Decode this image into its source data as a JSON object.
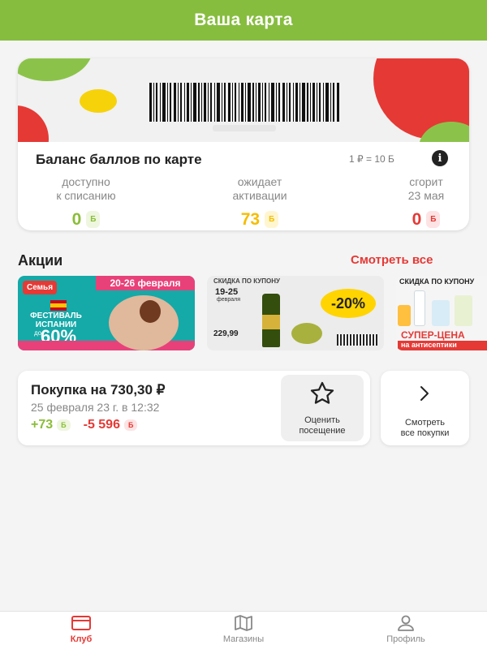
{
  "header": {
    "title": "Ваша карта"
  },
  "card": {
    "balance_title": "Баланс баллов по карте",
    "rate": "1 ₽ = 10 Б",
    "stats": [
      {
        "label_line1": "доступно",
        "label_line2": "к списанию",
        "value": "0",
        "unit": "Б",
        "color": "#8bbd39"
      },
      {
        "label_line1": "ожидает",
        "label_line2": "активации",
        "value": "73",
        "unit": "Б",
        "color": "#f5bd02"
      },
      {
        "label_line1": "сгорит",
        "label_line2": "23 мая",
        "value": "0",
        "unit": "Б",
        "color": "#e53935"
      }
    ]
  },
  "promos": {
    "title": "Акции",
    "see_all": "Смотреть все",
    "banners": [
      {
        "logo": "Семья",
        "date": "20-26 февраля",
        "festival": "ФЕСТИВАЛЬ ИСПАНИИ",
        "prefix": "до",
        "discount": "60%"
      },
      {
        "tag": "СКИДКА ПО КУПОНУ",
        "dates": "19-25",
        "month": "февраля",
        "discount": "-20%",
        "price": "229,99"
      },
      {
        "tag": "СКИДКА ПО КУПОНУ",
        "headline": "СУПЕР-ЦЕНА",
        "subline": "на антисептики"
      }
    ]
  },
  "purchase": {
    "title": "Покупка на 730,30 ₽",
    "date": "25 февраля 23 г. в 12:32",
    "earned": "+73",
    "spent": "-5 596",
    "unit": "Б",
    "rate_label_1": "Оценить",
    "rate_label_2": "посещение",
    "all_label_1": "Смотреть",
    "all_label_2": "все покупки"
  },
  "tabs": [
    {
      "label": "Клуб",
      "icon": "card-icon",
      "active": true
    },
    {
      "label": "Магазины",
      "icon": "map-icon",
      "active": false
    },
    {
      "label": "Профиль",
      "icon": "person-icon",
      "active": false
    }
  ],
  "colors": {
    "brand_green": "#87bd3f",
    "accent_red": "#e53935",
    "accent_yellow": "#f5bd02"
  }
}
